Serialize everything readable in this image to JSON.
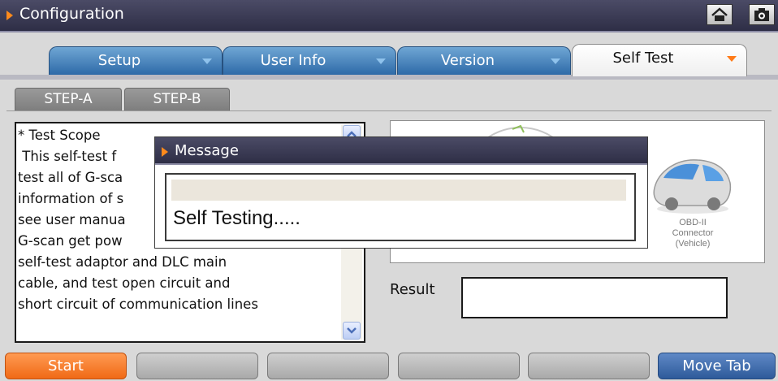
{
  "window": {
    "title": "Configuration",
    "buttons": [
      {
        "icon": "home-icon"
      },
      {
        "icon": "camera-icon"
      }
    ]
  },
  "tabs": [
    {
      "label": "Setup",
      "active": false
    },
    {
      "label": "User Info",
      "active": false
    },
    {
      "label": "Version",
      "active": false
    },
    {
      "label": "Self Test",
      "active": true
    }
  ],
  "steps": [
    {
      "label": "STEP-A",
      "active": true
    },
    {
      "label": "STEP-B",
      "active": false
    }
  ],
  "description": {
    "lines": [
      "* Test Scope",
      " This self-test f",
      "test all of G-sca",
      "information of s",
      "see user manua",
      "G-scan get pow",
      "self-test adaptor and DLC main",
      "cable, and test open circuit and",
      "short circuit of communication lines"
    ]
  },
  "diagram": {
    "connector_label": [
      "OBD-II",
      "Connector",
      "(Vehicle)"
    ]
  },
  "result": {
    "label": "Result",
    "value": ""
  },
  "dialog": {
    "title": "Message",
    "message": "Self Testing.....",
    "progress": 0
  },
  "footer": {
    "buttons": [
      {
        "label": "Start",
        "style": "orange"
      },
      {
        "label": "",
        "style": "gray"
      },
      {
        "label": "",
        "style": "gray"
      },
      {
        "label": "",
        "style": "gray"
      },
      {
        "label": "",
        "style": "gray"
      },
      {
        "label": "Move Tab",
        "style": "blue"
      }
    ]
  },
  "colors": {
    "accent_orange": "#ff8a1c",
    "tab_blue": "#2e6aa8",
    "titlebar": "#35354f"
  }
}
